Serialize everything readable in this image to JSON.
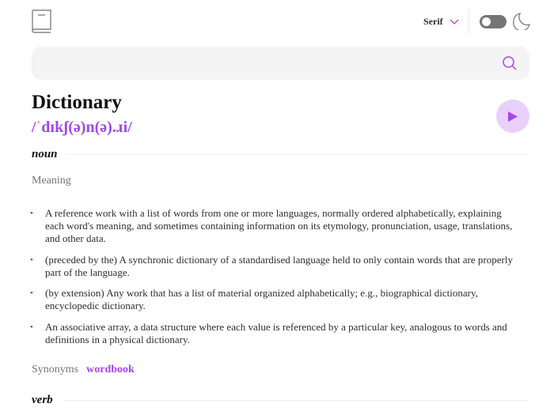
{
  "header": {
    "logo_icon": "book-icon",
    "font_label": "Serif",
    "theme_toggle_icon": "moon-icon"
  },
  "search": {
    "value": "",
    "placeholder": "",
    "icon": "search-icon"
  },
  "entry": {
    "word": "Dictionary",
    "phonetic": "/ˈdɪkʃ(ə)n(ə).ɹi/",
    "play_icon": "play-icon",
    "meanings": [
      {
        "part_of_speech": "noun",
        "meaning_label": "Meaning",
        "definitions": [
          "A reference work with a list of words from one or more languages, normally ordered alphabetically, explaining each word's meaning, and sometimes containing information on its etymology, pronunciation, usage, translations, and other data.",
          "(preceded by the) A synchronic dictionary of a standardised language held to only contain words that are properly part of the language.",
          "(by extension) Any work that has a list of material organized alphabetically; e.g., biographical dictionary, encyclopedic dictionary.",
          "An associative array, a data structure where each value is referenced by a particular key, analogous to words and definitions in a physical dictionary."
        ],
        "synonyms_label": "Synonyms",
        "synonyms": [
          "wordbook"
        ]
      },
      {
        "part_of_speech": "verb"
      }
    ]
  },
  "colors": {
    "accent": "#a445ed",
    "play_bg": "#e9d0fa",
    "search_bg": "#f4f4f4",
    "muted": "#757575"
  }
}
